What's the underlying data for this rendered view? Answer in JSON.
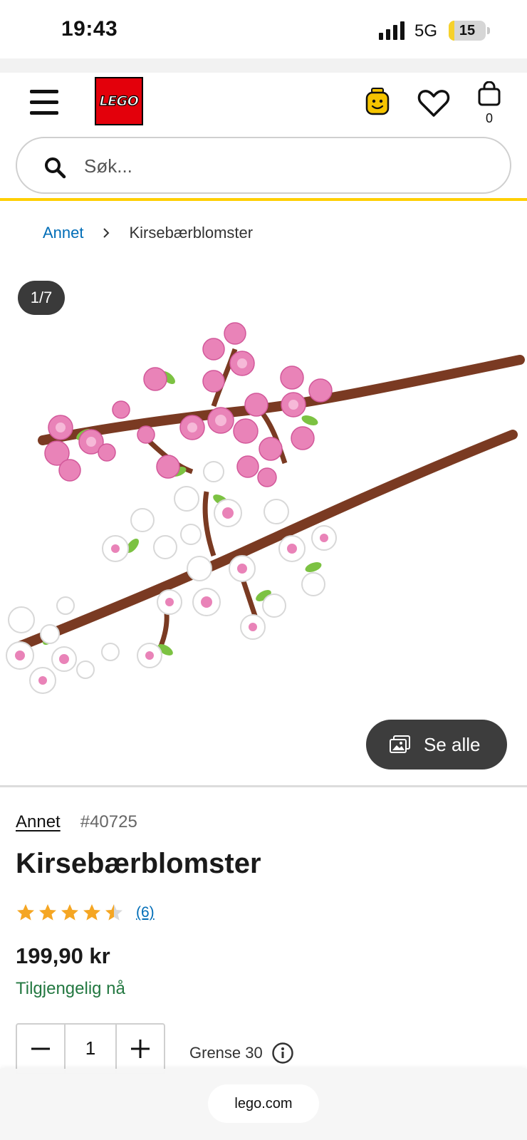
{
  "status_bar": {
    "time": "19:43",
    "network": "5G",
    "battery_level": "15",
    "battery_fraction": 0.15
  },
  "header": {
    "logo_text": "LEGO",
    "cart_count": "0",
    "search_placeholder": "Søk..."
  },
  "breadcrumb": {
    "parent": "Annet",
    "current": "Kirsebærblomster"
  },
  "gallery": {
    "counter": "1/7",
    "see_all_label": "Se alle"
  },
  "product": {
    "theme": "Annet",
    "number": "#40725",
    "title": "Kirsebærblomster",
    "rating": 4.5,
    "rating_max": 5,
    "review_count": "(6)",
    "price": "199,90 kr",
    "availability": "Tilgjengelig nå",
    "quantity": "1",
    "limit": "Grense 30"
  },
  "browser": {
    "url": "lego.com"
  },
  "colors": {
    "lego_red": "#e3000b",
    "header_accent": "#ffcf00",
    "link_blue": "#006db7",
    "available_green": "#237841",
    "star_orange": "#f5a623"
  }
}
